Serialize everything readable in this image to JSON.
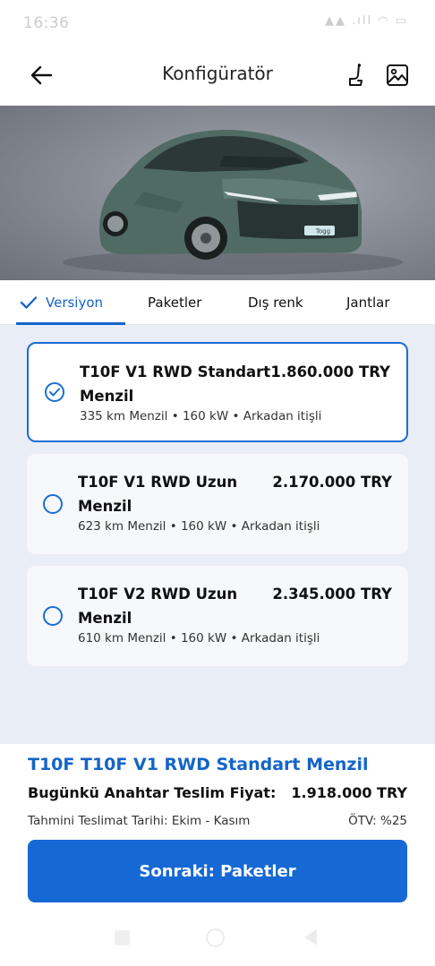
{
  "status_bar": {
    "time": "16:36",
    "icons": "▲▲ .ıll ◠ ▭"
  },
  "header": {
    "title": "Konfigüratör",
    "back_icon": "arrow-left-icon",
    "seat_icon": "seat-icon",
    "image_icon": "image-icon"
  },
  "hero": {
    "badge": "Togg"
  },
  "tabs": [
    {
      "label": "Versiyon",
      "active": true
    },
    {
      "label": "Paketler",
      "active": false
    },
    {
      "label": "Dış renk",
      "active": false
    },
    {
      "label": "Jantlar",
      "active": false
    }
  ],
  "versions": [
    {
      "name": "T10F V1 RWD Standart Menzil",
      "price": "1.860.000 TRY",
      "specs": "335 km Menzil  •  160 kW  •  Arkadan itişli",
      "selected": true
    },
    {
      "name": "T10F V1 RWD Uzun Menzil",
      "price": "2.170.000 TRY",
      "specs": "623 km Menzil  •  160 kW  •  Arkadan itişli",
      "selected": false
    },
    {
      "name": "T10F V2 RWD Uzun Menzil",
      "price": "2.345.000 TRY",
      "specs": "610 km Menzil  •  160 kW  •  Arkadan itişli",
      "selected": false
    }
  ],
  "summary": {
    "selected_name": "T10F T10F V1 RWD Standart Menzil",
    "price_label": "Bugünkü Anahtar Teslim Fiyat:",
    "price_value": "1.918.000 TRY",
    "delivery": "Tahmini Teslimat Tarihi: Ekim - Kasım",
    "otv": "ÖTV:  %25",
    "next_button": "Sonraki:  Paketler"
  },
  "colors": {
    "accent": "#1464c8",
    "car_body": "#4f6b64"
  }
}
